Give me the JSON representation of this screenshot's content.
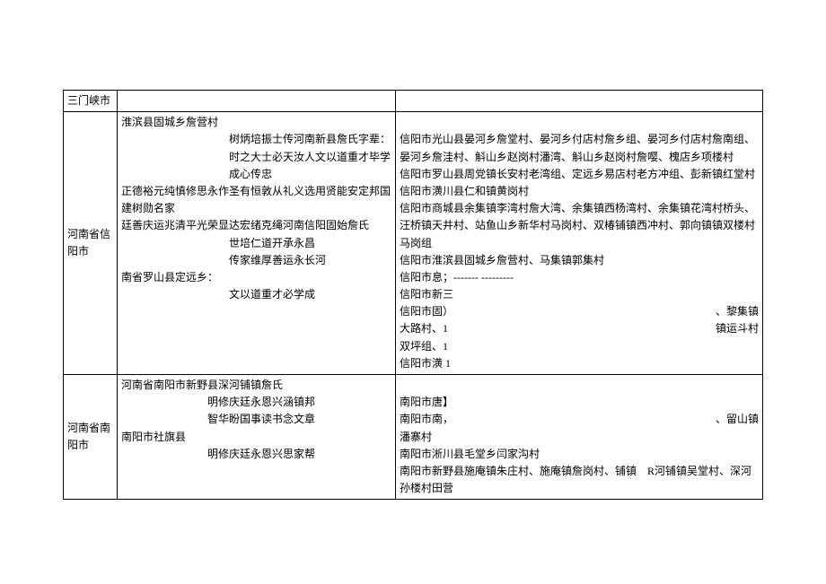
{
  "rows": [
    {
      "c1": "三门峡市",
      "c2": "",
      "c3": ""
    },
    {
      "c1": "河南省信阳市",
      "c2": {
        "l1": "淮滨县固城乡詹营村",
        "l2": "树炳培振士传河南新县詹氏字辈：",
        "l3": "时之大士必天汝人文以道重才毕学成心传忠",
        "l4": "正德裕元纯慎修思永作圣有恒敦从礼义选用贤能安定邦国建树勋名家",
        "l5": "廷善庆运兆清平光荣显达宏绪克绳河南信阳固始詹氏",
        "l6": "世培仁道开承永昌",
        "l7": "传家维厚善运永长河",
        "l8": "南省罗山县定远乡：",
        "l9": "文以道重才必学成"
      },
      "c3": {
        "p1": "信阳市光山县晏河乡詹堂村、晏河乡付店村詹乡组、晏河乡付店村詹南组、晏河乡詹洼村、斛山乡赵岗村潘湾、斛山乡赵岗村詹嘤、槐店乡项楼村",
        "p2": "信阳市罗山县周党镇长安村老湾组、定远乡易店村老方冲组、彭新镇红堂村",
        "p3": "信阳市潢川县仁和镇黄岗村",
        "p4": "信阳市商城县余集镇李湾村詹大湾、余集镇西杨湾村、余集镇花湾村桥头、汪桥镇天井村、站鱼山乡新华村马岗村、双椿铺镇西冲村、郭向镇镇双楼村马岗组",
        "p5": "信阳市淮滨县固城乡詹营村、马集镇郭集村",
        "p6": "信阳市息；------- ---------",
        "p7": "信阳市新三",
        "p8a": "信阳市固）",
        "p8b": "、黎集镇",
        "p9a": "大路村、1",
        "p9b": "镇运斗村",
        "p10": "双坪组、1",
        "p11": "信阳市潢 1"
      }
    },
    {
      "c1": "河南省南阳市",
      "c2": {
        "l1": "河南省南阳市新野县深河铺镇詹氏",
        "l2": "明修庆廷永恩兴涵镇邦",
        "l3": "智华盼国事读书念文章",
        "l4": "南阳市社旗县",
        "l5": "明修庆廷永恩兴思家帮"
      },
      "c3": {
        "p1": "南阳市唐】",
        "p2a": "南阳市南，",
        "p2b": "、留山镇",
        "p3": "潘寨村",
        "p4": "南阳市淅川县毛堂乡闫家沟村",
        "p5": "南阳市新野县施庵镇朱庄村、施庵镇詹岗村、铺镇　R河铺镇吴堂村、深河孙楼村田营"
      }
    }
  ]
}
